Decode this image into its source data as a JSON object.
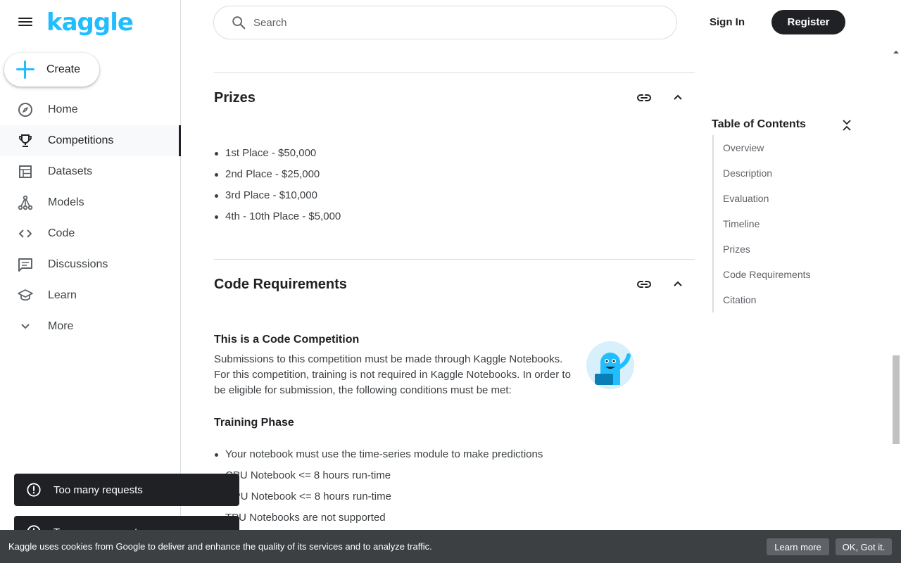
{
  "brand": {
    "logo_text": "kaggle",
    "accent_color": "#20beff"
  },
  "sidebar": {
    "create_label": "Create",
    "items": [
      {
        "label": "Home",
        "icon": "compass-icon"
      },
      {
        "label": "Competitions",
        "icon": "trophy-icon",
        "active": true
      },
      {
        "label": "Datasets",
        "icon": "table-icon"
      },
      {
        "label": "Models",
        "icon": "models-icon"
      },
      {
        "label": "Code",
        "icon": "code-icon"
      },
      {
        "label": "Discussions",
        "icon": "discussion-icon"
      },
      {
        "label": "Learn",
        "icon": "school-icon"
      },
      {
        "label": "More",
        "icon": "chevron-down-icon"
      }
    ]
  },
  "header": {
    "search_placeholder": "Search",
    "signin_label": "Sign In",
    "register_label": "Register"
  },
  "prizes": {
    "title": "Prizes",
    "items": [
      "1st Place - $50,000",
      "2nd Place - $25,000",
      "3rd Place - $10,000",
      "4th - 10th Place - $5,000"
    ]
  },
  "code_requirements": {
    "title": "Code Requirements",
    "subtitle": "This is a Code Competition",
    "paragraph": "Submissions to this competition must be made through Kaggle Notebooks. For this competition, training is not required in Kaggle Notebooks. In order to be eligible for submission, the following conditions must be met:",
    "training_title": "Training Phase",
    "training_items": [
      "Your notebook must use the time-series module to make predictions",
      "CPU Notebook <= 8 hours run-time",
      "GPU Notebook <= 8 hours run-time",
      "TPU Notebooks are not supported"
    ]
  },
  "toc": {
    "title": "Table of Contents",
    "items": [
      "Overview",
      "Description",
      "Evaluation",
      "Timeline",
      "Prizes",
      "Code Requirements",
      "Citation"
    ]
  },
  "toasts": [
    {
      "text": "Too many requests"
    },
    {
      "text": "Too many requests"
    }
  ],
  "cookie_bar": {
    "text": "Kaggle uses cookies from Google to deliver and enhance the quality of its services and to analyze traffic.",
    "learn_more_label": "Learn more",
    "ok_label": "OK, Got it."
  }
}
